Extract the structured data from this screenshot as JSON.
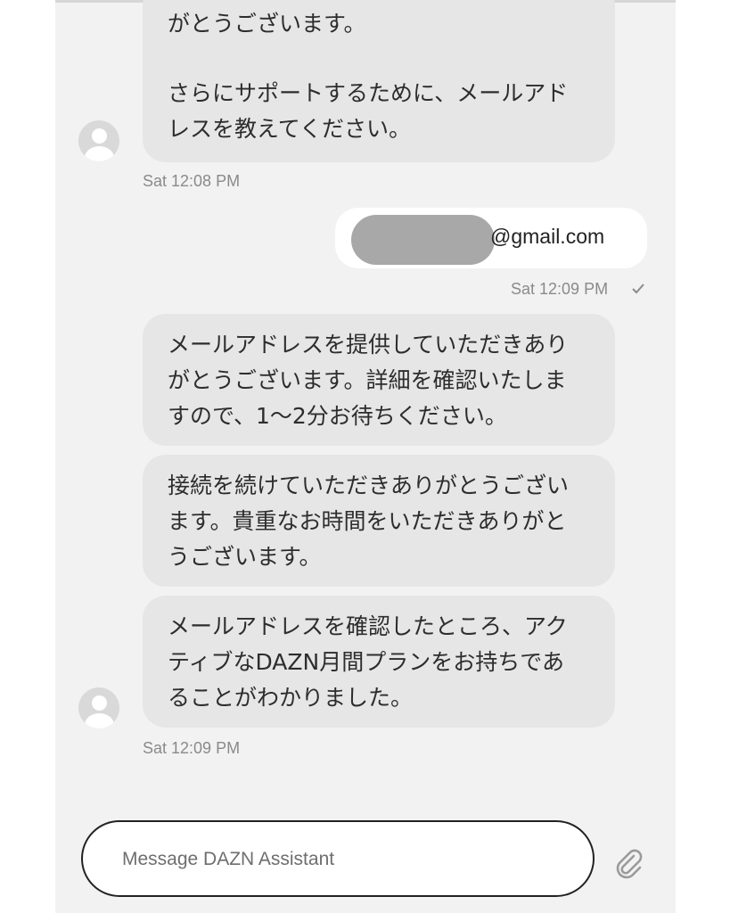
{
  "messages": [
    {
      "sender": "assistant",
      "lines": [
        "がとうございます。",
        "",
        "さらにサポートするために、メールアド",
        "レスを教えてください。"
      ],
      "timestamp": "Sat 12:08 PM"
    },
    {
      "sender": "user",
      "email_suffix": "@gmail.com",
      "timestamp": "Sat 12:09 PM",
      "status_icon": "check-icon"
    },
    {
      "sender": "assistant",
      "lines": [
        "メールアドレスを提供していただきあり",
        "がとうございます。詳細を確認いたしま",
        "すので、1～2分お待ちください。"
      ]
    },
    {
      "sender": "assistant",
      "lines": [
        "接続を続けていただきありがとうござい",
        "ます。貴重なお時間をいただきありがと",
        "うございます。"
      ]
    },
    {
      "sender": "assistant",
      "lines": [
        "メールアドレスを確認したところ、アク",
        "ティブなDAZN月間プランをお持ちであ",
        "ることがわかりました。"
      ],
      "timestamp": "Sat 12:09 PM"
    }
  ],
  "composer": {
    "placeholder": "Message DAZN Assistant",
    "attach_icon": "paperclip-icon"
  },
  "colors": {
    "background": "#f2f2f2",
    "assistant_bubble": "#e6e6e6",
    "user_bubble": "#ffffff",
    "timestamp": "#8a8a8a"
  }
}
